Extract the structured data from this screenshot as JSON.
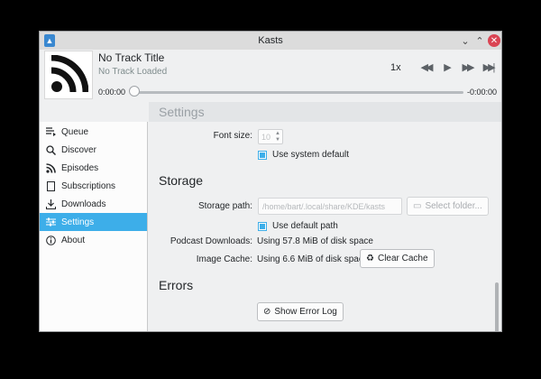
{
  "window": {
    "title": "Kasts"
  },
  "player": {
    "track_title": "No Track Title",
    "track_subtitle": "No Track Loaded",
    "playback_rate": "1x",
    "time_elapsed": "0:00:00",
    "time_remaining": "-0:00:00",
    "progress": 0
  },
  "sidebar": {
    "items": [
      {
        "label": "Queue",
        "icon": "queue-icon"
      },
      {
        "label": "Discover",
        "icon": "search-icon"
      },
      {
        "label": "Episodes",
        "icon": "rss-icon"
      },
      {
        "label": "Subscriptions",
        "icon": "document-icon"
      },
      {
        "label": "Downloads",
        "icon": "download-icon"
      },
      {
        "label": "Settings",
        "icon": "settings-icon",
        "active": true
      },
      {
        "label": "About",
        "icon": "info-icon"
      }
    ]
  },
  "settings": {
    "heading": "Settings",
    "font_size_label": "Font size:",
    "font_size_value": "10",
    "use_system_default_label": "Use system default",
    "use_system_default_checked": true,
    "storage_heading": "Storage",
    "storage_path_label": "Storage path:",
    "storage_path_value": "/home/bart/.local/share/KDE/kasts",
    "select_folder_label": "Select folder...",
    "use_default_path_label": "Use default path",
    "use_default_path_checked": true,
    "podcast_downloads_label": "Podcast Downloads:",
    "podcast_downloads_value": "Using 57.8 MiB of disk space",
    "image_cache_label": "Image Cache:",
    "image_cache_value": "Using 6.6 MiB of disk space",
    "clear_cache_label": "Clear Cache",
    "errors_heading": "Errors",
    "show_error_log_label": "Show Error Log"
  },
  "colors": {
    "accent": "#3daee9",
    "close": "#da4453"
  }
}
